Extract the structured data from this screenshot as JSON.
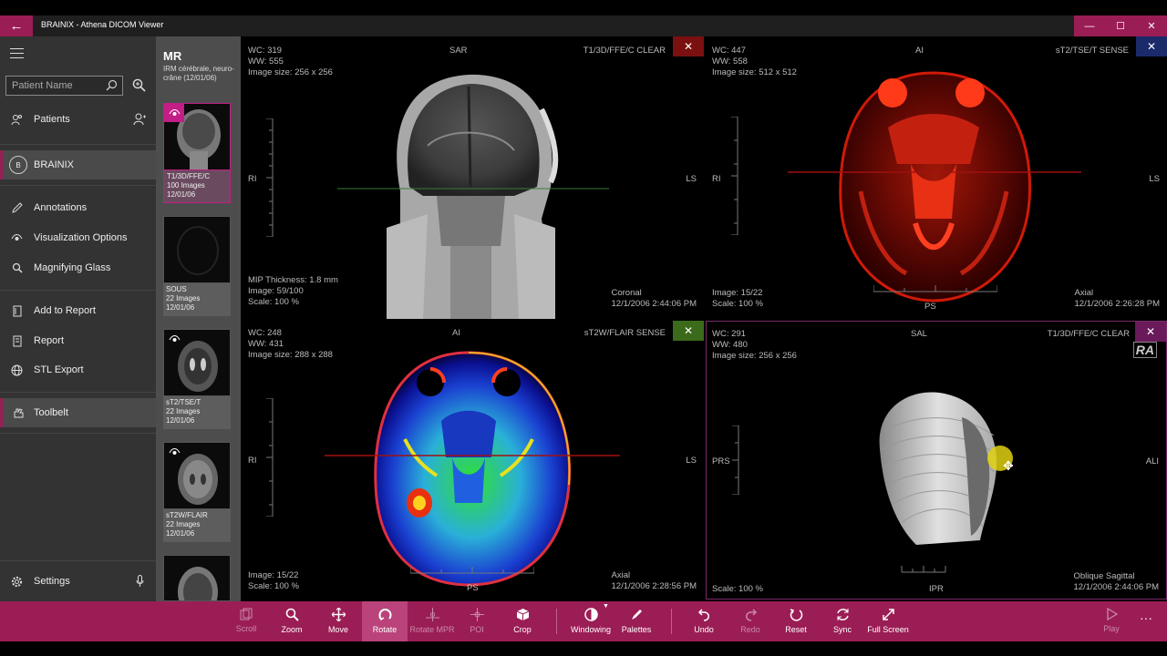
{
  "window": {
    "title": "BRAINIX - Athena DICOM Viewer",
    "back_icon": "arrow-left-icon",
    "controls": [
      "minimize",
      "maximize",
      "close"
    ]
  },
  "sidebar": {
    "search_placeholder": "Patient Name",
    "items": [
      {
        "label": "Patients",
        "icon": "patients-icon"
      },
      {
        "label": "BRAINIX",
        "icon": "patient-avatar-icon",
        "avatar_letter": "B"
      },
      {
        "label": "Annotations",
        "icon": "pencil-icon"
      },
      {
        "label": "Visualization Options",
        "icon": "eye-icon"
      },
      {
        "label": "Magnifying Glass",
        "icon": "magnifier-icon"
      },
      {
        "label": "Add to Report",
        "icon": "document-icon"
      },
      {
        "label": "Report",
        "icon": "report-icon"
      },
      {
        "label": "STL Export",
        "icon": "globe-icon"
      },
      {
        "label": "Toolbelt",
        "icon": "hand-icon"
      },
      {
        "label": "Settings",
        "icon": "gear-icon"
      }
    ]
  },
  "series_panel": {
    "modality": "MR",
    "study_description": "IRM cérébrale, neuro-crâne (12/01/06)",
    "series": [
      {
        "name": "T1/3D/FFE/C",
        "count": "100 Images",
        "date": "12/01/06"
      },
      {
        "name": "SOUS",
        "count": "22 Images",
        "date": "12/01/06"
      },
      {
        "name": "sT2/TSE/T",
        "count": "22 Images",
        "date": "12/01/06"
      },
      {
        "name": "sT2W/FLAIR",
        "count": "22 Images",
        "date": "12/01/06"
      }
    ]
  },
  "viewports": [
    {
      "wc": "WC: 319",
      "ww": "WW: 555",
      "size": "Image size: 256 x 256",
      "orient_top": "SAR",
      "orient_left": "RI",
      "orient_right": "LS",
      "orient_bottom": "",
      "series": "T1/3D/FFE/C CLEAR",
      "mip": "MIP Thickness: 1.8 mm",
      "image": "Image: 59/100",
      "scale": "Scale: 100 %",
      "plane": "Coronal",
      "datetime": "12/1/2006 2:44:06 PM",
      "close_color": "#7a1010"
    },
    {
      "wc": "WC: 447",
      "ww": "WW: 558",
      "size": "Image size: 512 x 512",
      "orient_top": "AI",
      "orient_left": "RI",
      "orient_right": "LS",
      "orient_bottom": "PS",
      "series": "sT2/TSE/T SENSE",
      "image": "Image: 15/22",
      "scale": "Scale: 100 %",
      "plane": "Axial",
      "datetime": "12/1/2006 2:26:28 PM",
      "close_color": "#1a2a6a"
    },
    {
      "wc": "WC: 248",
      "ww": "WW: 431",
      "size": "Image size: 288 x 288",
      "orient_top": "AI",
      "orient_left": "RI",
      "orient_right": "LS",
      "orient_bottom": "PS",
      "series": "sT2W/FLAIR SENSE",
      "image": "Image: 15/22",
      "scale": "Scale: 100 %",
      "plane": "Axial",
      "datetime": "12/1/2006 2:28:56 PM",
      "close_color": "#3a6a1a"
    },
    {
      "wc": "WC: 291",
      "ww": "WW: 480",
      "size": "Image size: 256 x 256",
      "orient_top": "SAL",
      "orient_left": "PRS",
      "orient_right": "ALI",
      "orient_bottom": "IPR",
      "series": "T1/3D/FFE/C CLEAR",
      "scale": "Scale: 100 %",
      "plane": "Oblique Sagittal",
      "datetime": "12/1/2006 2:44:06 PM",
      "badge": "RA",
      "close_color": "#6a1a5a"
    }
  ],
  "toolbar": {
    "tools": [
      {
        "label": "Scroll",
        "icon": "scroll-icon",
        "enabled": false
      },
      {
        "label": "Zoom",
        "icon": "zoom-icon",
        "enabled": true
      },
      {
        "label": "Move",
        "icon": "move-icon",
        "enabled": true
      },
      {
        "label": "Rotate",
        "icon": "rotate-icon",
        "enabled": true,
        "selected": true
      },
      {
        "label": "Rotate MPR",
        "icon": "rotate-mpr-icon",
        "enabled": false
      },
      {
        "label": "POI",
        "icon": "poi-icon",
        "enabled": false
      },
      {
        "label": "Crop",
        "icon": "crop-icon",
        "enabled": true
      },
      {
        "label": "Windowing",
        "icon": "windowing-icon",
        "enabled": true
      },
      {
        "label": "Palettes",
        "icon": "palette-icon",
        "enabled": true
      },
      {
        "label": "Undo",
        "icon": "undo-icon",
        "enabled": true
      },
      {
        "label": "Redo",
        "icon": "redo-icon",
        "enabled": false
      },
      {
        "label": "Reset",
        "icon": "reset-icon",
        "enabled": true
      },
      {
        "label": "Sync",
        "icon": "sync-icon",
        "enabled": true
      },
      {
        "label": "Full Screen",
        "icon": "fullscreen-icon",
        "enabled": true
      },
      {
        "label": "Play",
        "icon": "play-icon",
        "enabled": false
      }
    ],
    "more": "···"
  },
  "colors": {
    "accent": "#9b1d55",
    "sidebar_bg": "#333333",
    "series_bg": "#4d4d4d",
    "active_series": "#c31d86"
  }
}
